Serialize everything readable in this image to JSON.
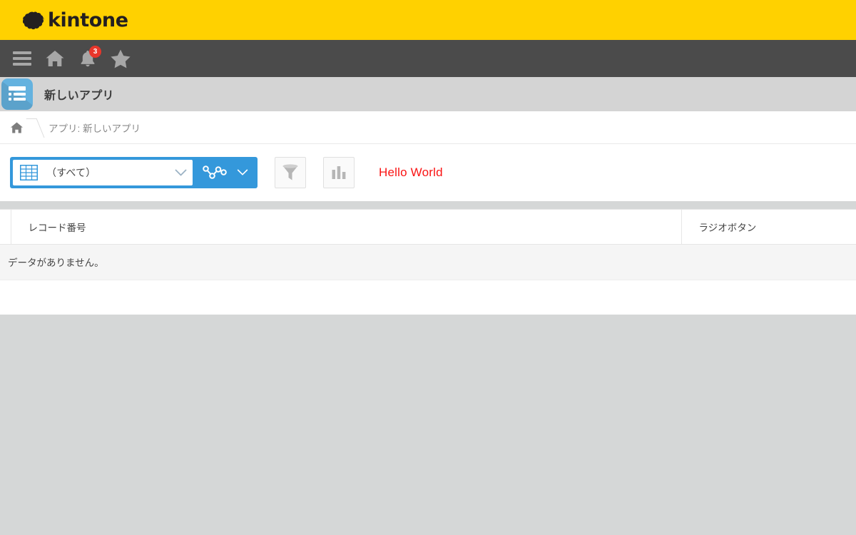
{
  "brand": {
    "name": "kintone",
    "mark_icon": "kintone-cloud-logo",
    "bar_color": "#ffd100"
  },
  "navbar": {
    "bar_color": "#4b4b4b",
    "items": [
      {
        "icon": "hamburger-menu-icon",
        "label": "メニュー"
      },
      {
        "icon": "home-icon",
        "label": "ホーム"
      },
      {
        "icon": "bell-icon",
        "label": "通知",
        "badge": "3",
        "badge_color": "#e8362b"
      },
      {
        "icon": "star-icon",
        "label": "お気に入り"
      }
    ]
  },
  "app_header": {
    "icon": "app-list-icon",
    "icon_color": "#64b2df",
    "title": "新しいアプリ",
    "bar_color": "#d4d4d4"
  },
  "breadcrumb": {
    "home_icon": "home-icon",
    "separator_icon": "chevron-right-icon",
    "text": "アプリ: 新しいアプリ"
  },
  "toolbar": {
    "accent_color": "#3498db",
    "view_select": {
      "icon": "table-view-icon",
      "value": "（すべて）",
      "chevron_icon": "chevron-down-icon"
    },
    "graph_button": {
      "icon": "line-graph-icon",
      "chevron_icon": "chevron-down-icon",
      "label": "グラフ"
    },
    "filter_button": {
      "icon": "funnel-filter-icon",
      "label": "絞り込む"
    },
    "chart_button": {
      "icon": "bar-chart-icon",
      "label": "集計する"
    },
    "custom_text": "Hello World",
    "custom_text_color": "#fa1414"
  },
  "record_list": {
    "columns": [
      {
        "key": "record_number",
        "label": "レコード番号"
      },
      {
        "key": "radio_button",
        "label": "ラジオボタン"
      }
    ],
    "rows": [],
    "empty_message": "データがありません。"
  }
}
